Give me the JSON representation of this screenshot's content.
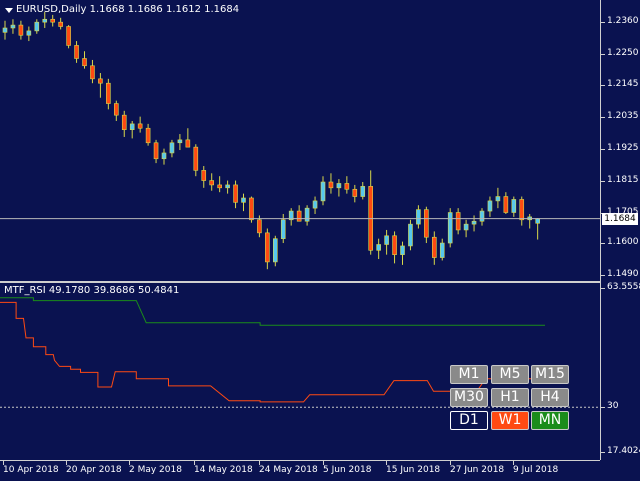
{
  "main_header": {
    "symbol": "EURUSD,Daily",
    "ohlc": "1.1668 1.1686 1.1612 1.1684"
  },
  "indicator_header": {
    "name": "MTF_RSI",
    "values": "49.1780 39.8686 50.4841"
  },
  "current_price": "1.1684",
  "price_axis": [
    "1.2360",
    "1.2250",
    "1.2145",
    "1.2035",
    "1.1925",
    "1.1815",
    "1.1705",
    "1.1600",
    "1.1490"
  ],
  "rsi_axis": {
    "top": "63.5558",
    "level": "30",
    "bottom": "17.4024"
  },
  "time_axis": [
    "10 Apr 2018",
    "20 Apr 2018",
    "2 May 2018",
    "14 May 2018",
    "24 May 2018",
    "5 Jun 2018",
    "15 Jun 2018",
    "27 Jun 2018",
    "9 Jul 2018"
  ],
  "timeframe_buttons": [
    {
      "label": "M1",
      "style": "default"
    },
    {
      "label": "M5",
      "style": "default"
    },
    {
      "label": "M15",
      "style": "default"
    },
    {
      "label": "M30",
      "style": "default"
    },
    {
      "label": "H1",
      "style": "default"
    },
    {
      "label": "H4",
      "style": "default"
    },
    {
      "label": "D1",
      "style": "current"
    },
    {
      "label": "W1",
      "style": "w1"
    },
    {
      "label": "MN",
      "style": "mn"
    }
  ],
  "colors": {
    "background": "#0a1250",
    "bull": "#55c8f0",
    "bear": "#ff4a12",
    "wick": "#d8d84a",
    "rsi_d1": "#ff4a12",
    "rsi_w1": "#1a8c1a",
    "grid": "#cfcfcf"
  },
  "chart_data": {
    "type": "candlestick",
    "symbol": "EURUSD",
    "timeframe": "Daily",
    "ylim": [
      1.149,
      1.2395
    ],
    "candles": [
      [
        1.2325,
        1.2365,
        1.23,
        1.234
      ],
      [
        1.234,
        1.237,
        1.232,
        1.235
      ],
      [
        1.235,
        1.2365,
        1.23,
        1.2315
      ],
      [
        1.2315,
        1.2345,
        1.2295,
        1.233
      ],
      [
        1.233,
        1.237,
        1.232,
        1.236
      ],
      [
        1.236,
        1.2395,
        1.234,
        1.237
      ],
      [
        1.237,
        1.2385,
        1.2345,
        1.236
      ],
      [
        1.236,
        1.2375,
        1.2335,
        1.2345
      ],
      [
        1.2345,
        1.235,
        1.227,
        1.228
      ],
      [
        1.228,
        1.2295,
        1.222,
        1.2235
      ],
      [
        1.2235,
        1.226,
        1.22,
        1.221
      ],
      [
        1.221,
        1.223,
        1.215,
        1.2165
      ],
      [
        1.2165,
        1.2185,
        1.21,
        1.215
      ],
      [
        1.215,
        1.2165,
        1.206,
        1.208
      ],
      [
        1.208,
        1.209,
        1.202,
        1.204
      ],
      [
        1.204,
        1.2055,
        1.1965,
        1.199
      ],
      [
        1.199,
        1.202,
        1.196,
        1.201
      ],
      [
        1.201,
        1.2035,
        1.198,
        1.1995
      ],
      [
        1.1995,
        1.201,
        1.1935,
        1.1945
      ],
      [
        1.1945,
        1.1955,
        1.1875,
        1.189
      ],
      [
        1.189,
        1.1925,
        1.187,
        1.191
      ],
      [
        1.191,
        1.1955,
        1.1895,
        1.1945
      ],
      [
        1.1945,
        1.1975,
        1.192,
        1.1955
      ],
      [
        1.1955,
        1.1995,
        1.194,
        1.193
      ],
      [
        1.193,
        1.194,
        1.183,
        1.185
      ],
      [
        1.185,
        1.1865,
        1.179,
        1.1815
      ],
      [
        1.1815,
        1.184,
        1.178,
        1.18
      ],
      [
        1.18,
        1.183,
        1.1775,
        1.179
      ],
      [
        1.179,
        1.1815,
        1.177,
        1.18
      ],
      [
        1.18,
        1.1815,
        1.172,
        1.174
      ],
      [
        1.174,
        1.177,
        1.171,
        1.1755
      ],
      [
        1.1755,
        1.176,
        1.167,
        1.168
      ],
      [
        1.168,
        1.1695,
        1.162,
        1.1635
      ],
      [
        1.1635,
        1.165,
        1.151,
        1.1535
      ],
      [
        1.1535,
        1.1625,
        1.152,
        1.1615
      ],
      [
        1.1615,
        1.17,
        1.16,
        1.168
      ],
      [
        1.168,
        1.172,
        1.166,
        1.171
      ],
      [
        1.171,
        1.173,
        1.169,
        1.1675
      ],
      [
        1.1675,
        1.173,
        1.166,
        1.172
      ],
      [
        1.172,
        1.176,
        1.17,
        1.1745
      ],
      [
        1.1745,
        1.183,
        1.173,
        1.181
      ],
      [
        1.181,
        1.184,
        1.177,
        1.179
      ],
      [
        1.179,
        1.182,
        1.176,
        1.1805
      ],
      [
        1.1805,
        1.183,
        1.177,
        1.1785
      ],
      [
        1.1785,
        1.18,
        1.174,
        1.176
      ],
      [
        1.176,
        1.181,
        1.175,
        1.1795
      ],
      [
        1.1795,
        1.185,
        1.156,
        1.1575
      ],
      [
        1.1575,
        1.1615,
        1.1545,
        1.1595
      ],
      [
        1.1595,
        1.1645,
        1.156,
        1.1625
      ],
      [
        1.1625,
        1.164,
        1.153,
        1.156
      ],
      [
        1.156,
        1.1605,
        1.1525,
        1.159
      ],
      [
        1.159,
        1.168,
        1.1575,
        1.1665
      ],
      [
        1.1665,
        1.173,
        1.165,
        1.1715
      ],
      [
        1.1715,
        1.1725,
        1.16,
        1.162
      ],
      [
        1.162,
        1.164,
        1.1525,
        1.155
      ],
      [
        1.155,
        1.1615,
        1.154,
        1.16
      ],
      [
        1.16,
        1.172,
        1.1585,
        1.1705
      ],
      [
        1.1705,
        1.172,
        1.163,
        1.1645
      ],
      [
        1.1645,
        1.168,
        1.162,
        1.1665
      ],
      [
        1.1665,
        1.1695,
        1.164,
        1.1675
      ],
      [
        1.1675,
        1.172,
        1.166,
        1.171
      ],
      [
        1.171,
        1.176,
        1.169,
        1.1745
      ],
      [
        1.1745,
        1.179,
        1.172,
        1.176
      ],
      [
        1.176,
        1.1775,
        1.17,
        1.1705
      ],
      [
        1.1705,
        1.176,
        1.169,
        1.175
      ],
      [
        1.175,
        1.176,
        1.166,
        1.168
      ],
      [
        1.168,
        1.17,
        1.165,
        1.169
      ],
      [
        1.1668,
        1.1686,
        1.1612,
        1.1684
      ]
    ],
    "rsi_ylim": [
      17.4024,
      63.5558
    ],
    "rsi_level": 30,
    "rsi_series": [
      {
        "name": "D1",
        "values": [
          [
            0,
            59.5
          ],
          [
            13,
            59.5
          ],
          [
            13,
            55
          ],
          [
            19,
            55
          ],
          [
            21,
            49.5
          ],
          [
            27,
            49.5
          ],
          [
            27,
            47
          ],
          [
            31,
            47
          ],
          [
            37,
            47
          ],
          [
            37,
            44.8
          ],
          [
            43,
            44.8
          ],
          [
            44,
            43.2
          ],
          [
            48,
            41.5
          ],
          [
            57,
            41.5
          ],
          [
            57,
            40.7
          ],
          [
            65,
            40.7
          ],
          [
            65,
            39.8
          ],
          [
            79,
            39.8
          ],
          [
            79,
            35.7
          ],
          [
            90,
            35.7
          ],
          [
            93,
            40
          ],
          [
            110,
            40
          ],
          [
            110,
            38
          ],
          [
            136,
            38
          ],
          [
            136,
            36
          ],
          [
            170,
            36
          ],
          [
            185,
            31.8
          ],
          [
            210,
            31.8
          ],
          [
            210,
            31.5
          ],
          [
            245,
            31.5
          ],
          [
            250,
            33.5
          ],
          [
            310,
            33.5
          ],
          [
            318,
            37.5
          ],
          [
            345,
            37.5
          ],
          [
            350,
            34.5
          ],
          [
            385,
            34.5
          ],
          [
            392,
            38
          ],
          [
            440,
            38
          ]
        ]
      },
      {
        "name": "W1",
        "values": [
          [
            0,
            60.8
          ],
          [
            27,
            60.8
          ],
          [
            27,
            60
          ],
          [
            110,
            60
          ],
          [
            118,
            53.8
          ],
          [
            210,
            53.8
          ],
          [
            210,
            53.1
          ],
          [
            440,
            53.1
          ]
        ]
      }
    ]
  }
}
